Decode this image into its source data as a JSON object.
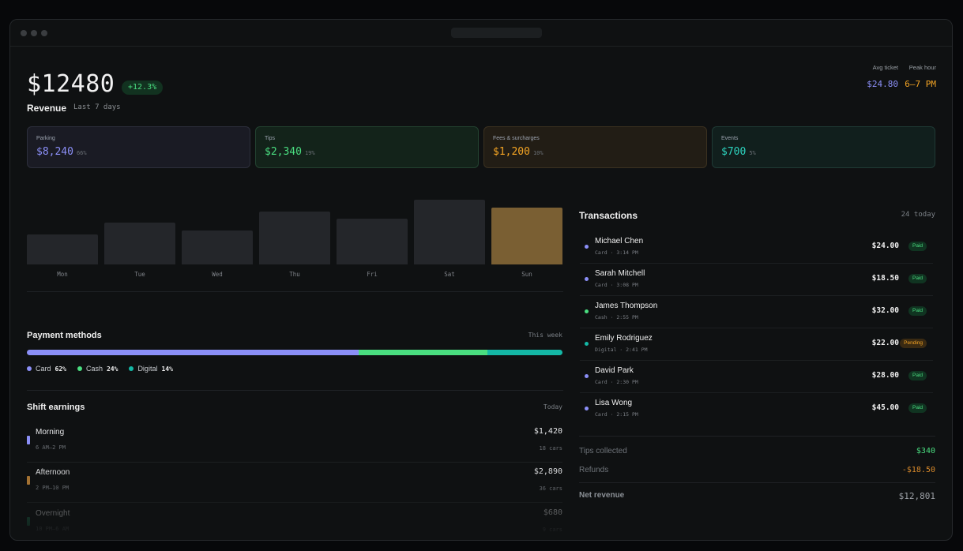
{
  "header": {
    "revenue_amount": "$12480",
    "revenue_change": "+12.3%",
    "revenue_label": "Revenue",
    "period": "Last 7 days",
    "stats": [
      {
        "label": "Avg ticket",
        "value": "$24.80",
        "color": "#8b8ff7"
      },
      {
        "label": "Peak hour",
        "value": "6–7 PM",
        "color": "#f5a524"
      }
    ]
  },
  "cards": [
    {
      "label": "Parking",
      "value": "$8,240",
      "pct": "66%",
      "color": "#8b8ff7"
    },
    {
      "label": "Tips",
      "value": "$2,340",
      "pct": "19%",
      "color": "#4ade80"
    },
    {
      "label": "Fees & surcharges",
      "value": "$1,200",
      "pct": "10%",
      "color": "#f5a524"
    },
    {
      "label": "Events",
      "value": "$700",
      "pct": "5%",
      "color": "#2dd4bf"
    }
  ],
  "chart_data": {
    "type": "bar",
    "categories": [
      "Mon",
      "Tue",
      "Wed",
      "Thu",
      "Fri",
      "Sat",
      "Sun"
    ],
    "values": [
      40,
      55,
      45,
      70,
      60,
      85,
      75
    ],
    "highlight": "Sun",
    "ylim": [
      0,
      100
    ],
    "grid": false
  },
  "payment_methods": {
    "title": "Payment methods",
    "period": "This week",
    "items": [
      {
        "label": "Card",
        "pct": "62%",
        "value": 62,
        "color": "#8b8ff7"
      },
      {
        "label": "Cash",
        "pct": "24%",
        "value": 24,
        "color": "#4ade80"
      },
      {
        "label": "Digital",
        "pct": "14%",
        "value": 14,
        "color": "#14b8a6"
      }
    ]
  },
  "shifts": {
    "title": "Shift earnings",
    "period": "Today",
    "items": [
      {
        "name": "Morning",
        "time": "6 AM–2 PM",
        "amount": "$1,420",
        "cars": "18 cars",
        "color": "#8b8ff7"
      },
      {
        "name": "Afternoon",
        "time": "2 PM–10 PM",
        "amount": "$2,890",
        "cars": "36 cars",
        "color": "#b07a35"
      },
      {
        "name": "Overnight",
        "time": "10 PM–6 AM",
        "amount": "$680",
        "cars": "9 cars",
        "color": "#1f7a55"
      }
    ]
  },
  "transactions": {
    "title": "Transactions",
    "count": "24 today",
    "items": [
      {
        "name": "Michael Chen",
        "meta": "Card · 3:14 PM",
        "amount": "$24.00",
        "status": "Paid",
        "dot": "#8b8ff7"
      },
      {
        "name": "Sarah Mitchell",
        "meta": "Card · 3:08 PM",
        "amount": "$18.50",
        "status": "Paid",
        "dot": "#8b8ff7"
      },
      {
        "name": "James Thompson",
        "meta": "Cash · 2:55 PM",
        "amount": "$32.00",
        "status": "Paid",
        "dot": "#4ade80"
      },
      {
        "name": "Emily Rodriguez",
        "meta": "Digital · 2:41 PM",
        "amount": "$22.00",
        "status": "Pending",
        "dot": "#14b8a6"
      },
      {
        "name": "David Park",
        "meta": "Card · 2:30 PM",
        "amount": "$28.00",
        "status": "Paid",
        "dot": "#8b8ff7"
      },
      {
        "name": "Lisa Wong",
        "meta": "Card · 2:15 PM",
        "amount": "$45.00",
        "status": "Paid",
        "dot": "#8b8ff7"
      }
    ]
  },
  "summary": {
    "tips_label": "Tips collected",
    "tips_value": "$340",
    "tips_color": "#4ade80",
    "refunds_label": "Refunds",
    "refunds_value": "-$18.50",
    "refunds_color": "#d98a2b",
    "net_label": "Net revenue",
    "net_value": "$12,801"
  }
}
